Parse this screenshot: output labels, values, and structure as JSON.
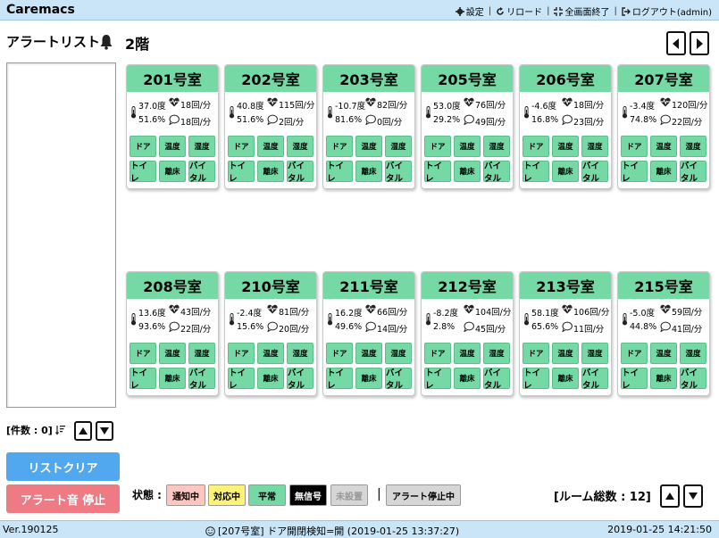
{
  "app": {
    "title": "Caremacs"
  },
  "topmenu": {
    "settings": "設定",
    "reload": "リロード",
    "fullscreen_exit": "全画面終了",
    "logout": "ログアウト(admin)",
    "separator": "|"
  },
  "header": {
    "alert_list_title": "アラートリスト",
    "floor": "2階"
  },
  "alert_list": {
    "count_label": "[件数 : 0]"
  },
  "buttons": {
    "clear": "リストクリア",
    "stop_sound": "アラート音 停止"
  },
  "status_legend": {
    "label": "状態 :",
    "items": [
      {
        "label": "通知中",
        "color": "#fdc7c1"
      },
      {
        "label": "対応中",
        "color": "#fff27a"
      },
      {
        "label": "平常",
        "color": "#74d9a4"
      },
      {
        "label": "無信号",
        "color": "#000000"
      },
      {
        "label": "未設置",
        "color": "#d6d6d6"
      }
    ],
    "divider": "|",
    "alert_stopped": "アラート停止中"
  },
  "room_total": "[ルーム総数 : 12]",
  "room_buttons": {
    "door": "ドア",
    "temperature": "温度",
    "humidity": "湿度",
    "toilet": "トイレ",
    "leave_bed": "離床",
    "vital": "バイタル"
  },
  "rooms": [
    {
      "name": "201号室",
      "temp": "37.0度",
      "humidity": "51.6%",
      "heart": "18回/分",
      "breath": "18回/分"
    },
    {
      "name": "202号室",
      "temp": "40.8度",
      "humidity": "51.6%",
      "heart": "115回/分",
      "breath": "2回/分"
    },
    {
      "name": "203号室",
      "temp": "-10.7度",
      "humidity": "81.6%",
      "heart": "82回/分",
      "breath": "0回/分"
    },
    {
      "name": "205号室",
      "temp": "53.0度",
      "humidity": "29.2%",
      "heart": "76回/分",
      "breath": "49回/分"
    },
    {
      "name": "206号室",
      "temp": "-4.6度",
      "humidity": "16.8%",
      "heart": "18回/分",
      "breath": "23回/分"
    },
    {
      "name": "207号室",
      "temp": "-3.4度",
      "humidity": "74.8%",
      "heart": "120回/分",
      "breath": "22回/分"
    },
    {
      "name": "208号室",
      "temp": "13.6度",
      "humidity": "93.6%",
      "heart": "43回/分",
      "breath": "22回/分"
    },
    {
      "name": "210号室",
      "temp": "-2.4度",
      "humidity": "15.6%",
      "heart": "81回/分",
      "breath": "20回/分"
    },
    {
      "name": "211号室",
      "temp": "16.2度",
      "humidity": "49.6%",
      "heart": "66回/分",
      "breath": "14回/分"
    },
    {
      "name": "212号室",
      "temp": "-8.2度",
      "humidity": "2.8%",
      "heart": "104回/分",
      "breath": "45回/分"
    },
    {
      "name": "213号室",
      "temp": "58.1度",
      "humidity": "65.6%",
      "heart": "106回/分",
      "breath": "11回/分"
    },
    {
      "name": "215号室",
      "temp": "-5.0度",
      "humidity": "44.8%",
      "heart": "59回/分",
      "breath": "41回/分"
    }
  ],
  "footer": {
    "version": "Ver.190125",
    "message": "[207号室] ドア開閉検知=開 (2019-01-25 13:37:27)",
    "datetime": "2019-01-25 14:21:50"
  }
}
